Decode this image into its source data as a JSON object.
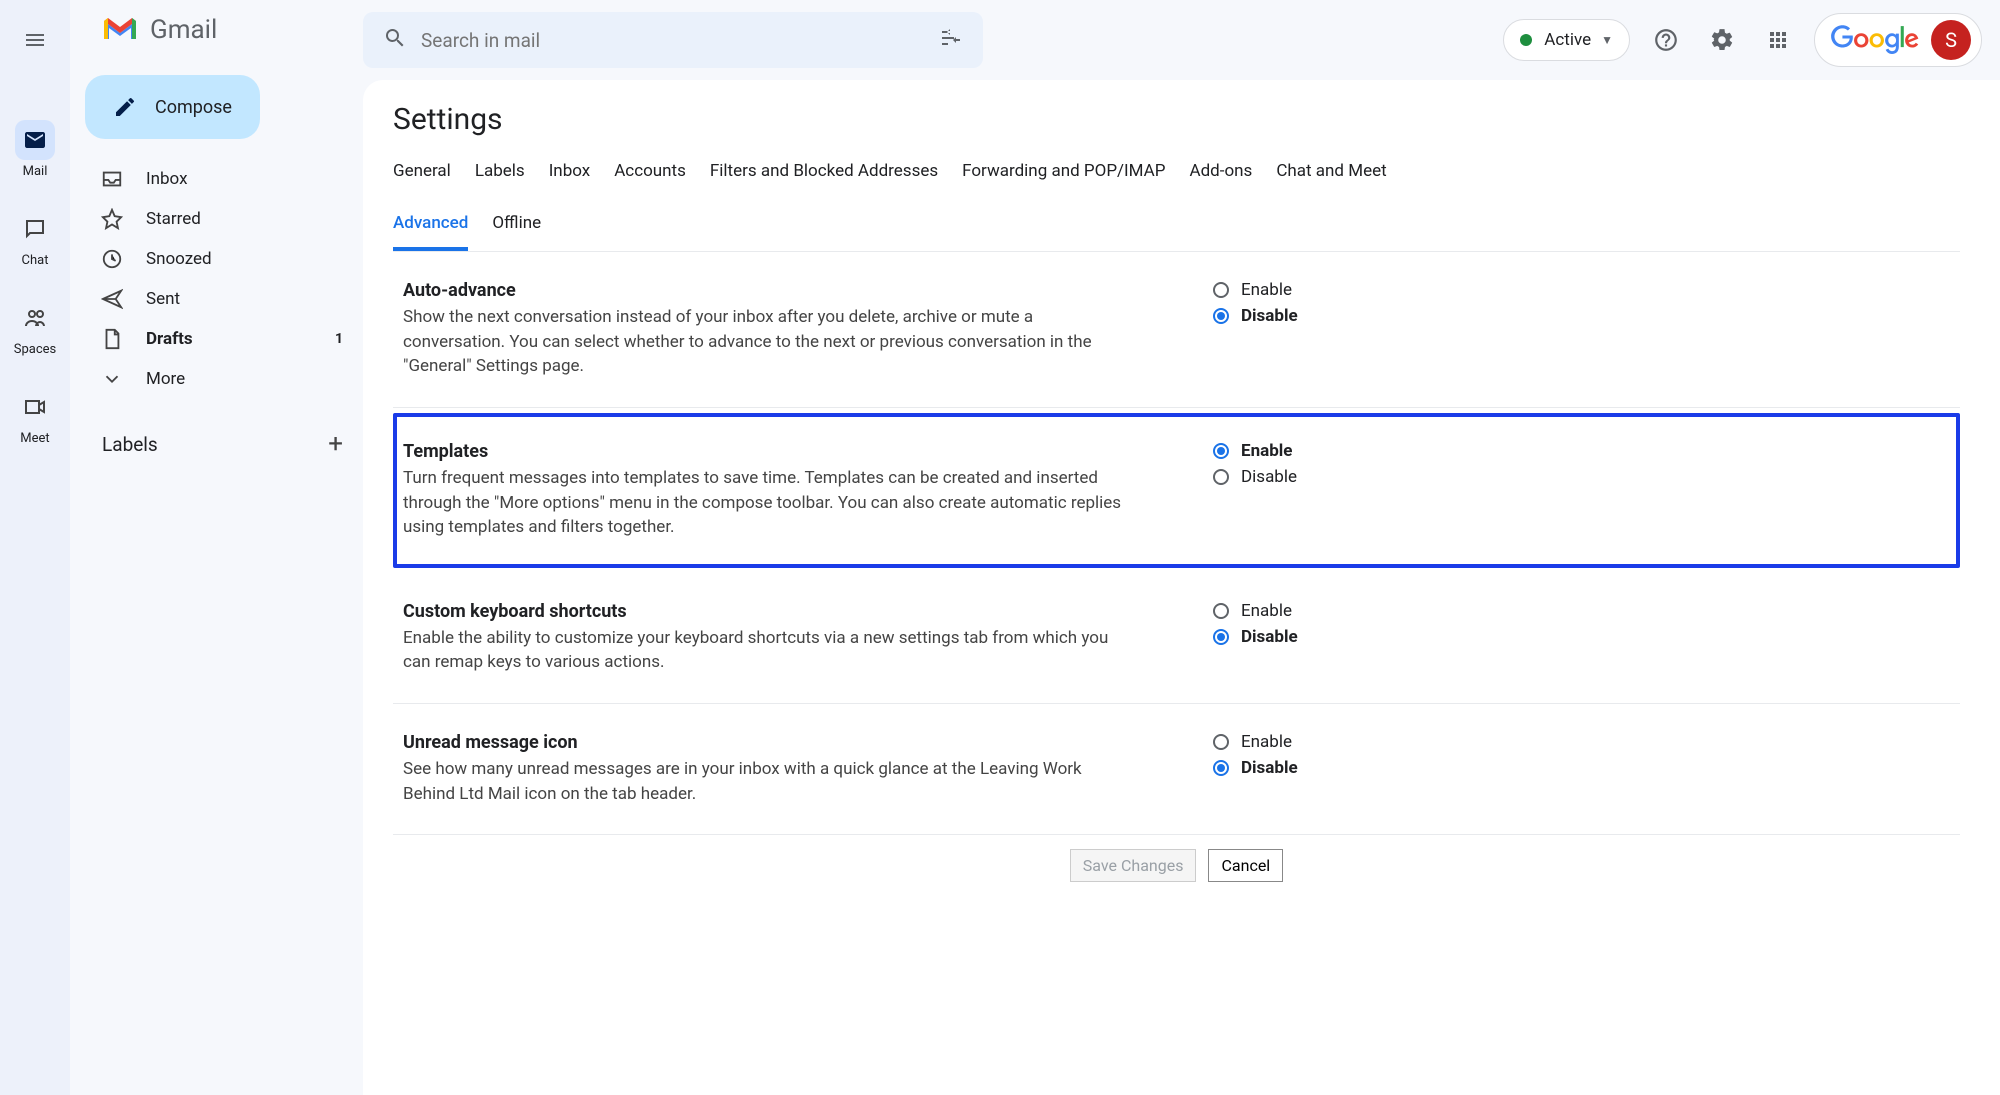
{
  "rail": {
    "items": [
      {
        "label": "Mail",
        "icon": "mail-icon",
        "active": true
      },
      {
        "label": "Chat",
        "icon": "chat-icon",
        "active": false
      },
      {
        "label": "Spaces",
        "icon": "spaces-icon",
        "active": false
      },
      {
        "label": "Meet",
        "icon": "meet-icon",
        "active": false
      }
    ]
  },
  "header": {
    "product_name": "Gmail",
    "search_placeholder": "Search in mail",
    "status_label": "Active",
    "google_label": "Google",
    "avatar_letter": "S"
  },
  "sidebar": {
    "compose_label": "Compose",
    "items": [
      {
        "label": "Inbox",
        "icon": "inbox-icon",
        "count": ""
      },
      {
        "label": "Starred",
        "icon": "star-icon",
        "count": ""
      },
      {
        "label": "Snoozed",
        "icon": "clock-icon",
        "count": ""
      },
      {
        "label": "Sent",
        "icon": "send-icon",
        "count": ""
      },
      {
        "label": "Drafts",
        "icon": "file-icon",
        "count": "1",
        "bold": true
      },
      {
        "label": "More",
        "icon": "chevron-down-icon",
        "count": ""
      }
    ],
    "labels_heading": "Labels"
  },
  "settings": {
    "page_title": "Settings",
    "tabs_row1": [
      "General",
      "Labels",
      "Inbox",
      "Accounts",
      "Filters and Blocked Addresses",
      "Forwarding and POP/IMAP",
      "Add-ons",
      "Chat and Meet"
    ],
    "tabs_row2": [
      "Advanced",
      "Offline"
    ],
    "active_tab": "Advanced",
    "options_enable": "Enable",
    "options_disable": "Disable",
    "sections": [
      {
        "title": "Auto-advance",
        "text": "Show the next conversation instead of your inbox after you delete, archive or mute a conversation. You can select whether to advance to the next or previous conversation in the \"General\" Settings page.",
        "value": "Disable",
        "highlighted": false
      },
      {
        "title": "Templates",
        "text": "Turn frequent messages into templates to save time. Templates can be created and inserted through the \"More options\" menu in the compose toolbar. You can also create automatic replies using templates and filters together.",
        "value": "Enable",
        "highlighted": true
      },
      {
        "title": "Custom keyboard shortcuts",
        "text": "Enable the ability to customize your keyboard shortcuts via a new settings tab from which you can remap keys to various actions.",
        "value": "Disable",
        "highlighted": false
      },
      {
        "title": "Unread message icon",
        "text": "See how many unread messages are in your inbox with a quick glance at the Leaving Work Behind Ltd Mail icon on the tab header.",
        "value": "Disable",
        "highlighted": false
      }
    ],
    "save_label": "Save Changes",
    "cancel_label": "Cancel"
  }
}
